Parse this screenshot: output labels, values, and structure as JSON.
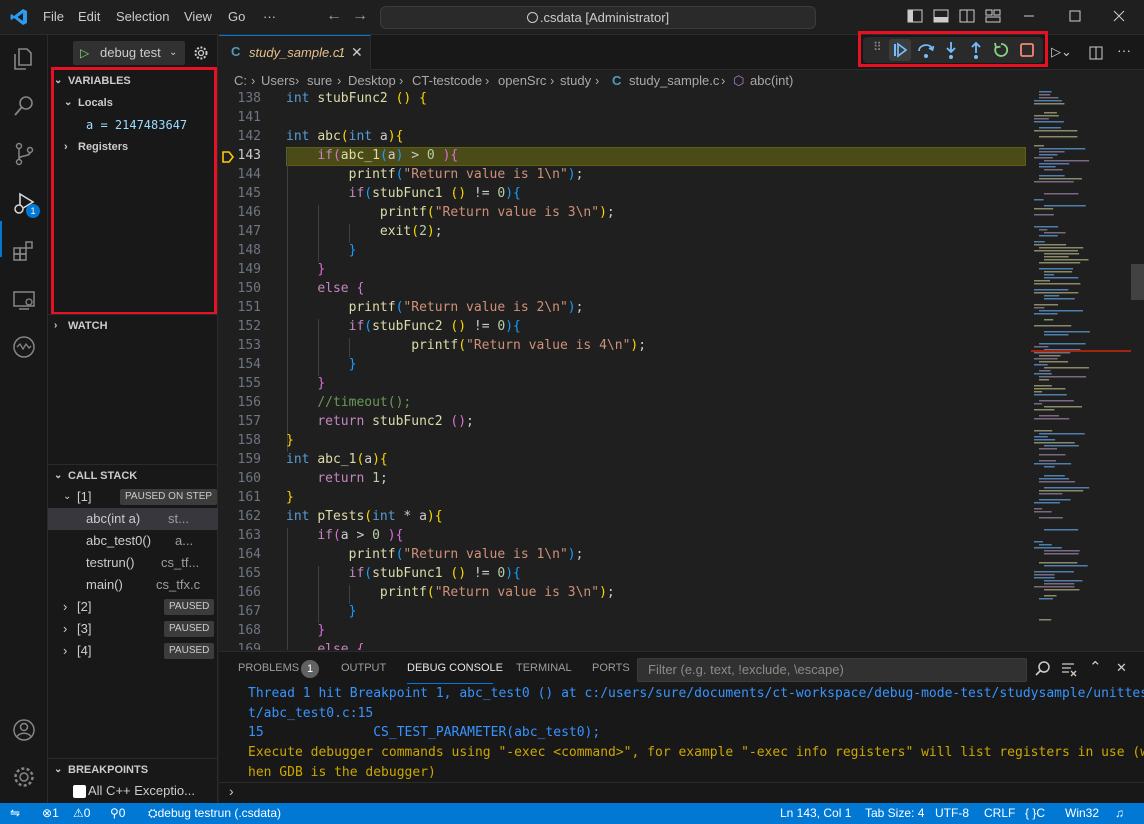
{
  "titlebar": {
    "menus": [
      "File",
      "Edit",
      "Selection",
      "View",
      "Go",
      "···"
    ],
    "search_text": ".csdata [Administrator]"
  },
  "sidebar": {
    "run_config": "debug test",
    "variables_header": "VARIABLES",
    "locals_label": "Locals",
    "local_var": "a = 2147483647",
    "registers_label": "Registers",
    "watch_header": "WATCH",
    "callstack_header": "CALL STACK",
    "threads": [
      {
        "label": "[1]",
        "status": "PAUSED ON STEP"
      },
      {
        "label": "[2]",
        "status": "PAUSED"
      },
      {
        "label": "[3]",
        "status": "PAUSED"
      },
      {
        "label": "[4]",
        "status": "PAUSED"
      }
    ],
    "frames": [
      {
        "name": "abc(int a)",
        "file": "st..."
      },
      {
        "name": "abc_test0()",
        "file": "a..."
      },
      {
        "name": "testrun()",
        "file": "cs_tf..."
      },
      {
        "name": "main()",
        "file": "cs_tfx.c"
      }
    ],
    "breakpoints_header": "BREAKPOINTS",
    "bp_item": "All C++ Exceptio..."
  },
  "tab": {
    "label": "study_sample.c",
    "badge": "1"
  },
  "breadcrumb": [
    "C:",
    "Users",
    "sure",
    "Desktop",
    "CT-testcode",
    "openSrc",
    "study",
    "study_sample.c",
    "abc(int)"
  ],
  "editor": {
    "line_numbers": [
      "138",
      "141",
      "142",
      "143",
      "144",
      "145",
      "146",
      "147",
      "148",
      "149",
      "150",
      "151",
      "152",
      "153",
      "154",
      "155",
      "156",
      "157",
      "158",
      "159",
      "160",
      "161",
      "162",
      "163",
      "164",
      "165",
      "166",
      "167",
      "168",
      "169"
    ],
    "current_line": "143"
  },
  "panel": {
    "tabs": [
      "PROBLEMS",
      "OUTPUT",
      "DEBUG CONSOLE",
      "TERMINAL",
      "PORTS"
    ],
    "problems_count": "1",
    "filter_placeholder": "Filter (e.g. text, !exclude, \\escape)",
    "console": [
      "Thread 1 hit Breakpoint 1, abc_test0 () at c:/users/sure/documents/ct-workspace/debug-mode-test/studysample/unittes",
      "t/abc_test0.c:15",
      "15              CS_TEST_PARAMETER(abc_test0);",
      "Execute debugger commands using \"-exec <command>\", for example \"-exec info registers\" will list registers in use (w",
      "hen GDB is the debugger)"
    ]
  },
  "statusbar": {
    "errors": "1",
    "warnings": "0",
    "ports": "0",
    "debug": "debug testrun (.csdata)",
    "position": "Ln 143, Col 1",
    "tabsize": "Tab Size: 4",
    "encoding": "UTF-8",
    "eol": "CRLF",
    "language": "C",
    "platform": "Win32"
  },
  "colors": {
    "accent": "#0078d4",
    "highlight_box": "#e81123",
    "current_line": "#4b4b18"
  }
}
